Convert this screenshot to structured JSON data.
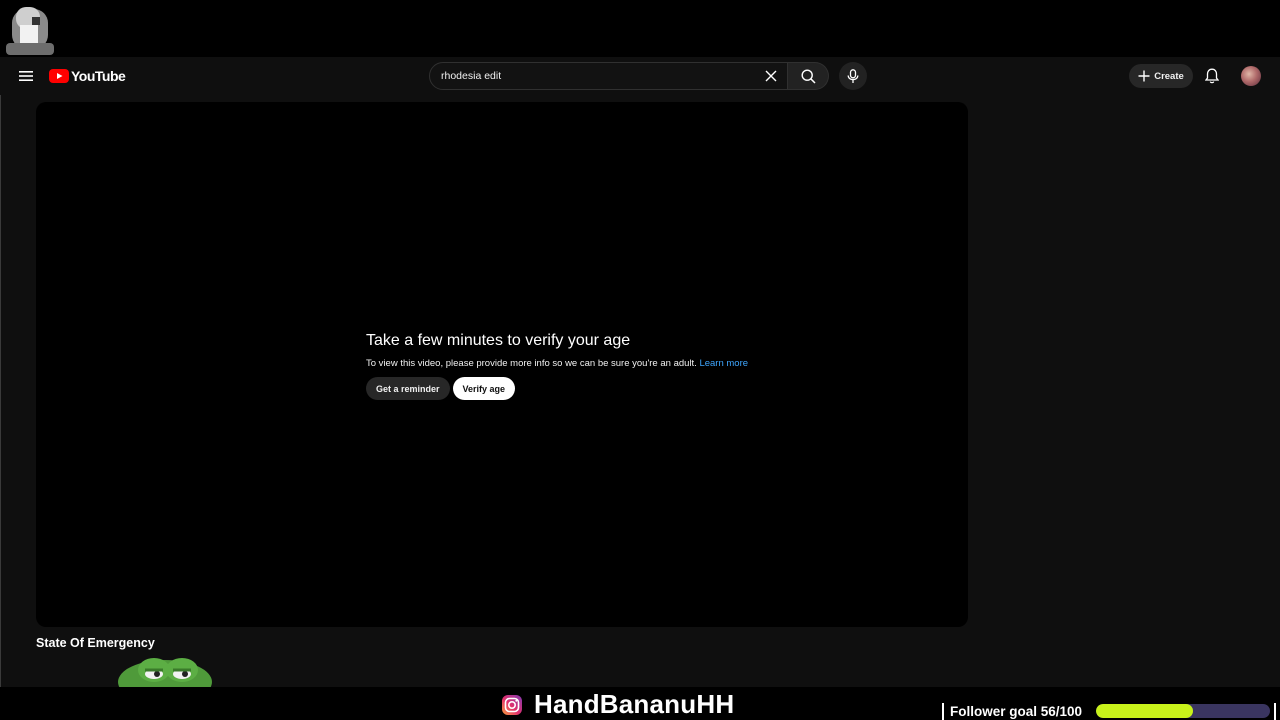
{
  "stream_overlay": {
    "follower_goal_label": "Follower goal 56/100",
    "follower_goal_progress": 0.56,
    "social_handle": "HandBananuHH",
    "social_icon": "instagram-icon",
    "accent_color": "#c8f21a",
    "track_color": "#3a3560"
  },
  "header": {
    "logo_text": "YouTube",
    "search": {
      "value": "rhodesia edit"
    },
    "create_label": "Create",
    "icons": [
      "menu-icon",
      "youtube-play-icon",
      "close-icon",
      "search-icon",
      "mic-icon",
      "plus-icon",
      "bell-icon"
    ]
  },
  "player": {
    "verify_title": "Take a few minutes to verify your age",
    "verify_desc": "To view this video, please provide more info so we can be sure you're an adult.",
    "learn_more": "Learn more",
    "reminder_label": "Get a reminder",
    "verify_label": "Verify age"
  },
  "video": {
    "title": "State Of Emergency"
  },
  "colors": {
    "background": "#0f0f0f",
    "brand_red": "#ff0000",
    "link_blue": "#3ea6ff"
  }
}
